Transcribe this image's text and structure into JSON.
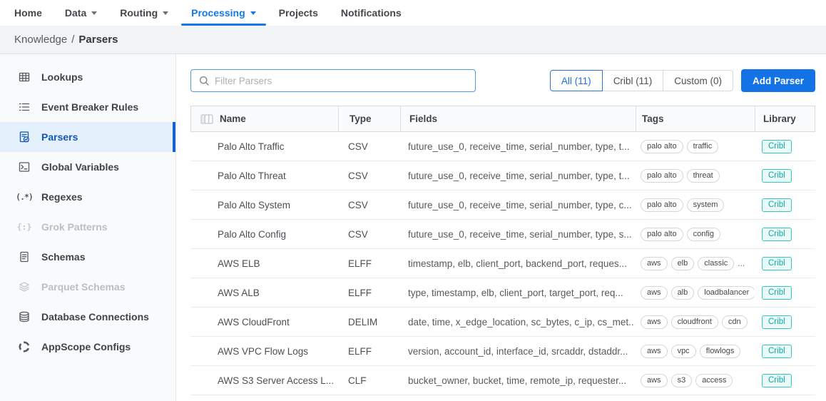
{
  "nav": {
    "items": [
      {
        "label": "Home",
        "caret": false,
        "active": false
      },
      {
        "label": "Data",
        "caret": true,
        "active": false
      },
      {
        "label": "Routing",
        "caret": true,
        "active": false
      },
      {
        "label": "Processing",
        "caret": true,
        "active": true
      },
      {
        "label": "Projects",
        "caret": false,
        "active": false
      },
      {
        "label": "Notifications",
        "caret": false,
        "active": false
      }
    ]
  },
  "breadcrumb": {
    "section": "Knowledge",
    "separator": "/",
    "page": "Parsers"
  },
  "sidebar": {
    "items": [
      {
        "label": "Lookups",
        "icon": "table-grid-icon",
        "state": "default"
      },
      {
        "label": "Event Breaker Rules",
        "icon": "list-icon",
        "state": "default"
      },
      {
        "label": "Parsers",
        "icon": "parser-document-icon",
        "state": "active"
      },
      {
        "label": "Global Variables",
        "icon": "terminal-icon",
        "state": "default"
      },
      {
        "label": "Regexes",
        "icon": "regex-icon",
        "state": "default"
      },
      {
        "label": "Grok Patterns",
        "icon": "grok-icon",
        "state": "disabled"
      },
      {
        "label": "Schemas",
        "icon": "schema-document-icon",
        "state": "default"
      },
      {
        "label": "Parquet Schemas",
        "icon": "layers-icon",
        "state": "disabled"
      },
      {
        "label": "Database Connections",
        "icon": "database-icon",
        "state": "default"
      },
      {
        "label": "AppScope Configs",
        "icon": "appscope-icon",
        "state": "default"
      }
    ]
  },
  "toolbar": {
    "filter_placeholder": "Filter Parsers",
    "tabs": [
      {
        "label": "All (11)",
        "active": true
      },
      {
        "label": "Cribl (11)",
        "active": false
      },
      {
        "label": "Custom (0)",
        "active": false
      }
    ],
    "add_button": "Add Parser"
  },
  "table": {
    "columns": [
      "Name",
      "Type",
      "Fields",
      "Tags",
      "Library"
    ],
    "rows": [
      {
        "name": "Palo Alto Traffic",
        "type": "CSV",
        "fields": "future_use_0, receive_time, serial_number, type, t...",
        "tags": [
          "palo alto",
          "traffic"
        ],
        "tags_more": "",
        "library": "Cribl"
      },
      {
        "name": "Palo Alto Threat",
        "type": "CSV",
        "fields": "future_use_0, receive_time, serial_number, type, t...",
        "tags": [
          "palo alto",
          "threat"
        ],
        "tags_more": "",
        "library": "Cribl"
      },
      {
        "name": "Palo Alto System",
        "type": "CSV",
        "fields": "future_use_0, receive_time, serial_number, type, c...",
        "tags": [
          "palo alto",
          "system"
        ],
        "tags_more": "",
        "library": "Cribl"
      },
      {
        "name": "Palo Alto Config",
        "type": "CSV",
        "fields": "future_use_0, receive_time, serial_number, type, s...",
        "tags": [
          "palo alto",
          "config"
        ],
        "tags_more": "",
        "library": "Cribl"
      },
      {
        "name": "AWS ELB",
        "type": "ELFF",
        "fields": "timestamp, elb, client_port, backend_port, reques...",
        "tags": [
          "aws",
          "elb",
          "classic"
        ],
        "tags_more": "...",
        "library": "Cribl"
      },
      {
        "name": "AWS ALB",
        "type": "ELFF",
        "fields": "type, timestamp, elb, client_port, target_port, req...",
        "tags": [
          "aws",
          "alb",
          "loadbalancer"
        ],
        "tags_more": "",
        "library": "Cribl"
      },
      {
        "name": "AWS CloudFront",
        "type": "DELIM",
        "fields": "date, time, x_edge_location, sc_bytes, c_ip, cs_met...",
        "tags": [
          "aws",
          "cloudfront",
          "cdn"
        ],
        "tags_more": "",
        "library": "Cribl"
      },
      {
        "name": "AWS VPC Flow Logs",
        "type": "ELFF",
        "fields": "version, account_id, interface_id, srcaddr, dstaddr...",
        "tags": [
          "aws",
          "vpc",
          "flowlogs"
        ],
        "tags_more": "",
        "library": "Cribl"
      },
      {
        "name": "AWS S3 Server Access L...",
        "type": "CLF",
        "fields": "bucket_owner, bucket, time, remote_ip, requester...",
        "tags": [
          "aws",
          "s3",
          "access"
        ],
        "tags_more": "",
        "library": "Cribl"
      }
    ]
  },
  "colors": {
    "accent_blue": "#1373e6",
    "nav_active_blue": "#1479e8",
    "sidebar_active_text": "#1256b5",
    "sidebar_active_bg": "#e4f1fc",
    "sidebar_active_bar": "#1163d2",
    "badge_teal_border": "#36c6c0",
    "badge_teal_text": "#0fa8a2",
    "badge_teal_bg": "#eafaf9"
  }
}
